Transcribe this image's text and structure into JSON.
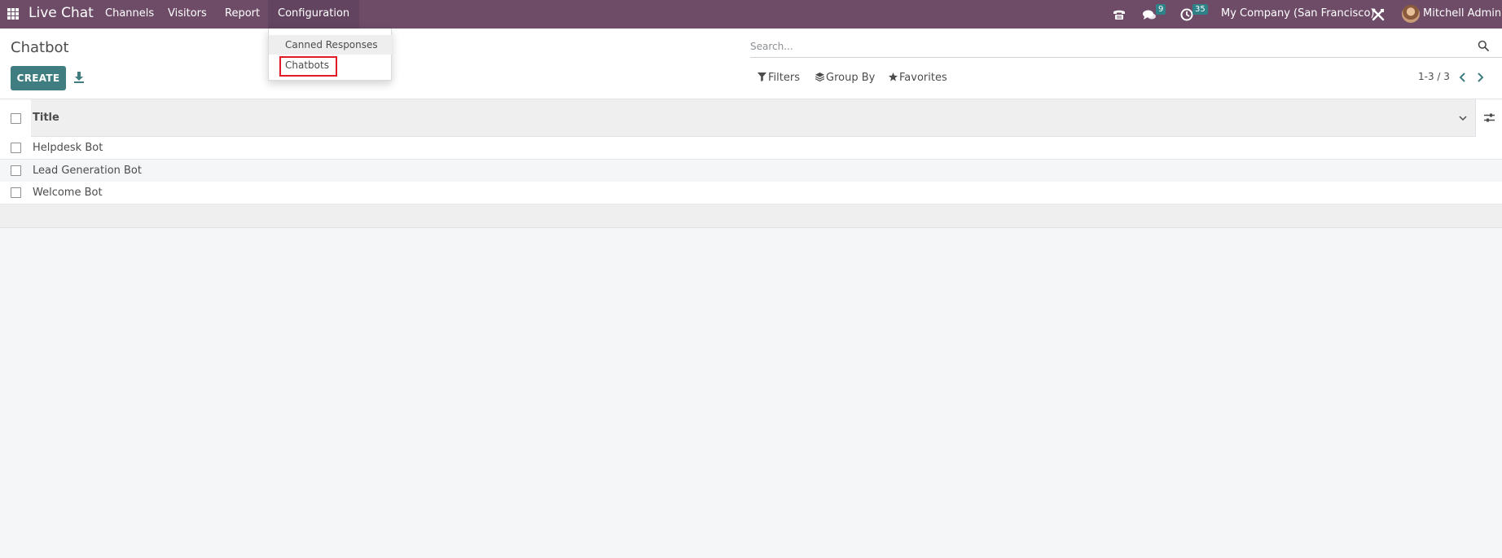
{
  "navbar": {
    "app_name": "Live Chat",
    "menu": [
      {
        "label": "Channels"
      },
      {
        "label": "Visitors"
      },
      {
        "label": "Report"
      },
      {
        "label": "Configuration"
      }
    ],
    "messages_count": "9",
    "activities_count": "35",
    "company": "My Company (San Francisco)",
    "user": "Mitchell Admin",
    "icons": [
      "apps-grid-icon",
      "phone-icon",
      "messages-icon",
      "activity-clock-icon",
      "debug-tools-icon"
    ]
  },
  "configuration_dropdown": {
    "items": [
      {
        "label": "Canned Responses"
      },
      {
        "label": "Chatbots"
      }
    ],
    "highlighted_item": "Chatbots"
  },
  "control_panel": {
    "breadcrumb": "Chatbot",
    "create_label": "CREATE",
    "search_placeholder": "Search...",
    "filters_label": "Filters",
    "group_by_label": "Group By",
    "favorites_label": "Favorites",
    "pager_value": "1-3 / 3"
  },
  "list": {
    "columns": [
      {
        "label": "Title"
      }
    ],
    "rows": [
      {
        "title": "Helpdesk Bot"
      },
      {
        "title": "Lead Generation Bot"
      },
      {
        "title": "Welcome Bot"
      }
    ]
  },
  "colors": {
    "navbar": "#6e4c68",
    "primary": "#3f7d80",
    "badge": "#2d8187",
    "highlight_border": "#e01b24"
  }
}
